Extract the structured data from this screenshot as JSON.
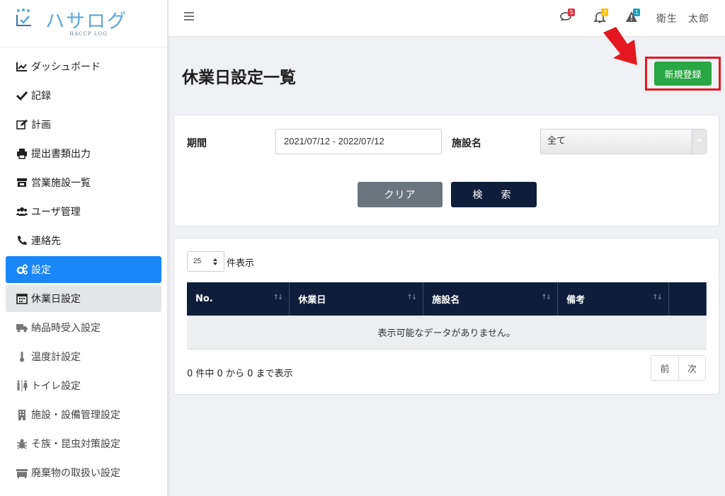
{
  "app": {
    "brand": "ハサログ",
    "brand_sub": "HACCP LOG"
  },
  "sidebar": {
    "items": [
      {
        "label": "ダッシュボード",
        "icon": "chart-line-icon"
      },
      {
        "label": "記録",
        "icon": "check-icon"
      },
      {
        "label": "計画",
        "icon": "edit-icon"
      },
      {
        "label": "提出書類出力",
        "icon": "printer-icon"
      },
      {
        "label": "営業施設一覧",
        "icon": "store-icon"
      },
      {
        "label": "ユーザ管理",
        "icon": "users-icon"
      },
      {
        "label": "連絡先",
        "icon": "phone-icon"
      },
      {
        "label": "設定",
        "icon": "cogs-icon"
      },
      {
        "label": "休業日設定",
        "icon": "calendar-icon"
      },
      {
        "label": "納品時受入設定",
        "icon": "truck-icon"
      },
      {
        "label": "温度計設定",
        "icon": "thermometer-icon"
      },
      {
        "label": "トイレ設定",
        "icon": "restroom-icon"
      },
      {
        "label": "施設・設備管理設定",
        "icon": "building-icon"
      },
      {
        "label": "そ族・昆虫対策設定",
        "icon": "bug-icon"
      },
      {
        "label": "廃棄物の取扱い設定",
        "icon": "dumpster-icon"
      }
    ]
  },
  "header": {
    "user": "衛生　太郎",
    "badges": {
      "messages": "5",
      "notifications": "2",
      "alerts": "1"
    },
    "colors": {
      "messages": "#dc3545",
      "notifications": "#ffc107",
      "alerts": "#17a2b8"
    }
  },
  "page": {
    "title": "休業日設定一覧",
    "new_label": "新規登録"
  },
  "filter": {
    "period_label": "期間",
    "period_value": "2021/07/12 - 2022/07/12",
    "facility_label": "施設名",
    "facility_value": "全て",
    "clear_label": "クリア",
    "search_label": "検　索"
  },
  "table": {
    "length_value": "25",
    "length_label": "件表示",
    "columns": [
      "No.",
      "休業日",
      "施設名",
      "備考"
    ],
    "empty_message": "表示可能なデータがありません。",
    "info": "0 件中 0 から 0 まで表示",
    "prev_label": "前",
    "next_label": "次"
  }
}
